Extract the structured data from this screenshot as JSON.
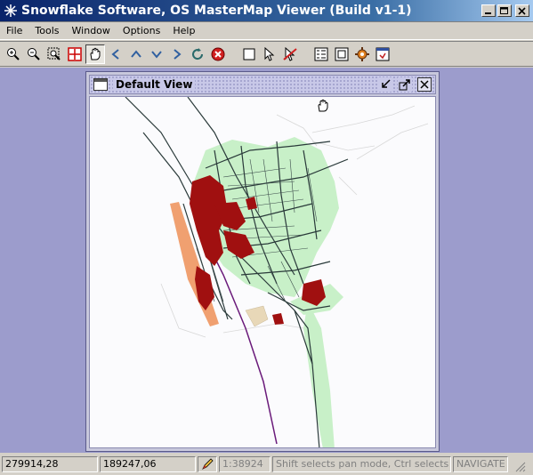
{
  "window": {
    "title": "Snowflake Software, OS MasterMap Viewer (Build  v1-1)",
    "app_icon": "snowflake-icon"
  },
  "menu": [
    "File",
    "Tools",
    "Window",
    "Options",
    "Help"
  ],
  "toolbar": {
    "buttons": [
      "zoom-in-icon",
      "zoom-out-icon",
      "zoom-box-icon",
      "zoom-extent-icon",
      "pan-hand-icon",
      "nav-left-icon",
      "nav-up-icon",
      "nav-down-icon",
      "nav-right-icon",
      "refresh-icon",
      "stop-icon",
      "select-box-icon",
      "select-pointer-icon",
      "clear-selection-icon",
      "layers-icon",
      "properties-icon",
      "settings-icon",
      "info-icon"
    ],
    "pressed": "pan-hand-icon"
  },
  "frame": {
    "title": "Default View"
  },
  "status": {
    "x_coord": "279914,28",
    "y_coord": "189247,06",
    "scale": "1:38924",
    "hint": "Shift selects pan mode, Ctrl selects zo...",
    "mode": "NAVIGATE"
  },
  "colors": {
    "desktop": "#9c9ccc",
    "buildings": "#a01010",
    "roads": "#2a3a3a",
    "green": "#c8f0c8",
    "orange": "#f0a070",
    "rail": "#6a1a7a"
  }
}
